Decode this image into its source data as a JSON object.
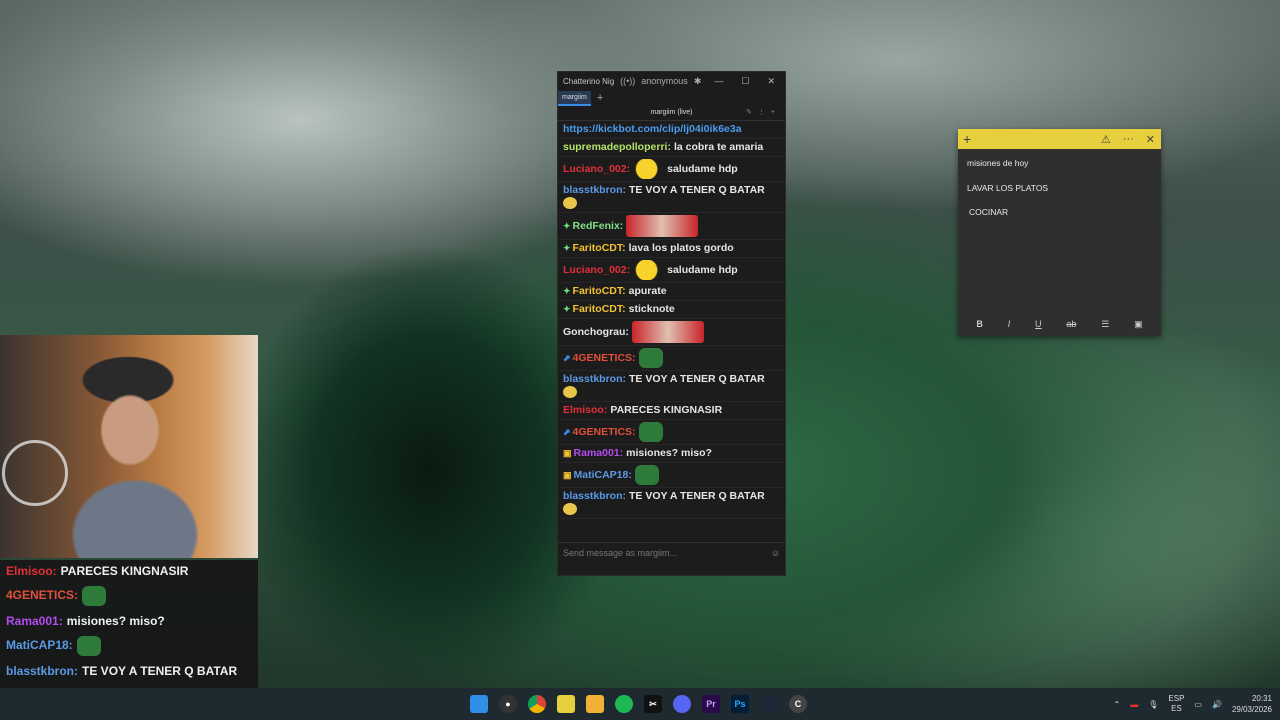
{
  "chatterino": {
    "window_title": "Chatterino Nig",
    "user": "anonymous",
    "tab": "margiim",
    "channel_header": "margiim (live)",
    "input_placeholder": "Send message as margiim...",
    "messages": [
      {
        "user": "",
        "text": "https://kickbot.com/clip/lj04i0ik6e3a",
        "color": "#4c9cf0",
        "emote": ""
      },
      {
        "user": "supremadepolloperri:",
        "text": "la cobra te amaria",
        "color": "#b6e36a",
        "emote": ""
      },
      {
        "user": "Luciano_002:",
        "text": "saludame hdp",
        "color": "#e0303a",
        "emote": "ok"
      },
      {
        "user": "blasstkbron:",
        "text": "TE VOY A TENER Q BATAR",
        "color": "#5b9ae6",
        "emote": "face"
      },
      {
        "user": "RedFenix:",
        "text": "",
        "color": "#7fe08a",
        "emote": "red",
        "badge": "g"
      },
      {
        "user": "FaritoCDT:",
        "text": "lava los platos gordo",
        "color": "#f2c230",
        "emote": "",
        "badge": "g"
      },
      {
        "user": "Luciano_002:",
        "text": "saludame hdp",
        "color": "#e0303a",
        "emote": "ok"
      },
      {
        "user": "FaritoCDT:",
        "text": "apurate",
        "color": "#f2c230",
        "emote": "",
        "badge": "g"
      },
      {
        "user": "FaritoCDT:",
        "text": "sticknote",
        "color": "#f2c230",
        "emote": "",
        "badge": "g"
      },
      {
        "user": "Gonchograu:",
        "text": "",
        "color": "#e6e6e6",
        "emote": "red"
      },
      {
        "user": "4GENETICS:",
        "text": "",
        "color": "#e0503a",
        "emote": "frog",
        "badge": "b"
      },
      {
        "user": "blasstkbron:",
        "text": "TE VOY A TENER Q BATAR",
        "color": "#5b9ae6",
        "emote": "face"
      },
      {
        "user": "Elmisoo:",
        "text": "PARECES KINGNASIR",
        "color": "#e0303a",
        "emote": ""
      },
      {
        "user": "4GENETICS:",
        "text": "",
        "color": "#e0503a",
        "emote": "frog",
        "badge": "b"
      },
      {
        "user": "Rama001:",
        "text": "misiones? miso?",
        "color": "#b54cf0",
        "emote": "",
        "badge": "y"
      },
      {
        "user": "MatiCAP18:",
        "text": "",
        "color": "#5b9ae6",
        "emote": "frog",
        "badge": "y"
      },
      {
        "user": "blasstkbron:",
        "text": "TE VOY A TENER Q BATAR",
        "color": "#5b9ae6",
        "emote": "face"
      }
    ]
  },
  "sticky_note": {
    "lines": [
      "misiones de hoy",
      "LAVAR LOS PLATOS",
      "COCINAR"
    ]
  },
  "overlay": {
    "messages": [
      {
        "user": "Elmisoo:",
        "text": "PARECES KINGNASIR",
        "color": "#e0303a"
      },
      {
        "user": "4GENETICS:",
        "text": "",
        "color": "#e0503a"
      },
      {
        "user": "Rama001:",
        "text": "misiones? miso?",
        "color": "#b54cf0"
      },
      {
        "user": "MatiCAP18:",
        "text": "",
        "color": "#5b9ae6"
      },
      {
        "user": "blasstkbron:",
        "text": "TE VOY A TENER Q BATAR",
        "color": "#5b9ae6"
      }
    ]
  },
  "taskbar": {
    "lang_top": "ESP",
    "lang_bottom": "ES",
    "time": "20:31",
    "date": "29/03/2026"
  }
}
